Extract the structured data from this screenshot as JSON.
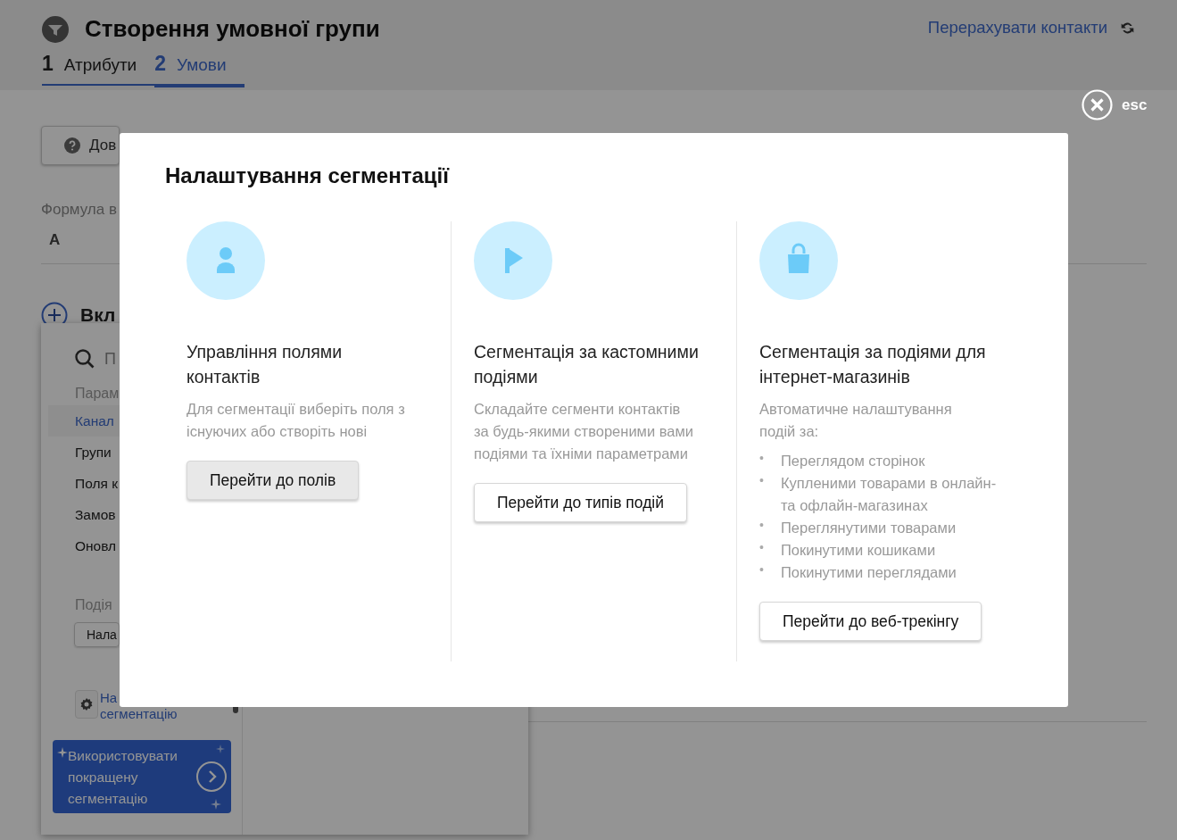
{
  "header": {
    "title": "Створення умовної групи",
    "recalc_link": "Перерахувати контакти",
    "steps": [
      {
        "number": "1",
        "label": "Атрибути",
        "selected": false
      },
      {
        "number": "2",
        "label": "Умови",
        "selected": true
      }
    ]
  },
  "close": {
    "label": "esc"
  },
  "background": {
    "help_button": "Дов",
    "formula_label": "Формула в",
    "formula_value": "A",
    "include_label": "Вкл"
  },
  "popup": {
    "search_placeholder": "П",
    "section_label": "Парам",
    "items": [
      {
        "label": "Канал",
        "selected": true
      },
      {
        "label": "Групи",
        "selected": false
      },
      {
        "label": "Поля к",
        "selected": false
      },
      {
        "label": "Замов",
        "selected": false
      },
      {
        "label": "Оновл",
        "selected": false
      }
    ],
    "event_label": "Подія",
    "event_field": "Нала",
    "settings_link": "На сегментацію",
    "promo": "Використовувати покращену сегментацію"
  },
  "modal": {
    "title": "Налаштування сегментації",
    "columns": [
      {
        "kind": "fields",
        "title": "Управління полями контактів",
        "description": "Для сегментації виберіть поля з існуючих або створіть нові",
        "button": "Перейти до полів",
        "highlighted": true
      },
      {
        "kind": "events",
        "title": "Сегментація за кастомними подіями",
        "description": "Складайте сегменти контактів за будь-якими створеними вами подіями та їхніми параметрами",
        "button": "Перейти до типів подій",
        "highlighted": false
      },
      {
        "kind": "ecommerce",
        "title": "Сегментація за подіями для інтернет-магазинів",
        "description": "Автоматичне налаштування подій за:",
        "marker": "•",
        "bullets": [
          "Переглядом сторінок",
          "Купленими товарами в онлайн- та офлайн-магазинах",
          "Переглянутими товарами",
          "Покинутими кошиками",
          "Покинутими переглядами"
        ],
        "button": "Перейти до веб-трекінгу",
        "highlighted": false
      }
    ]
  }
}
